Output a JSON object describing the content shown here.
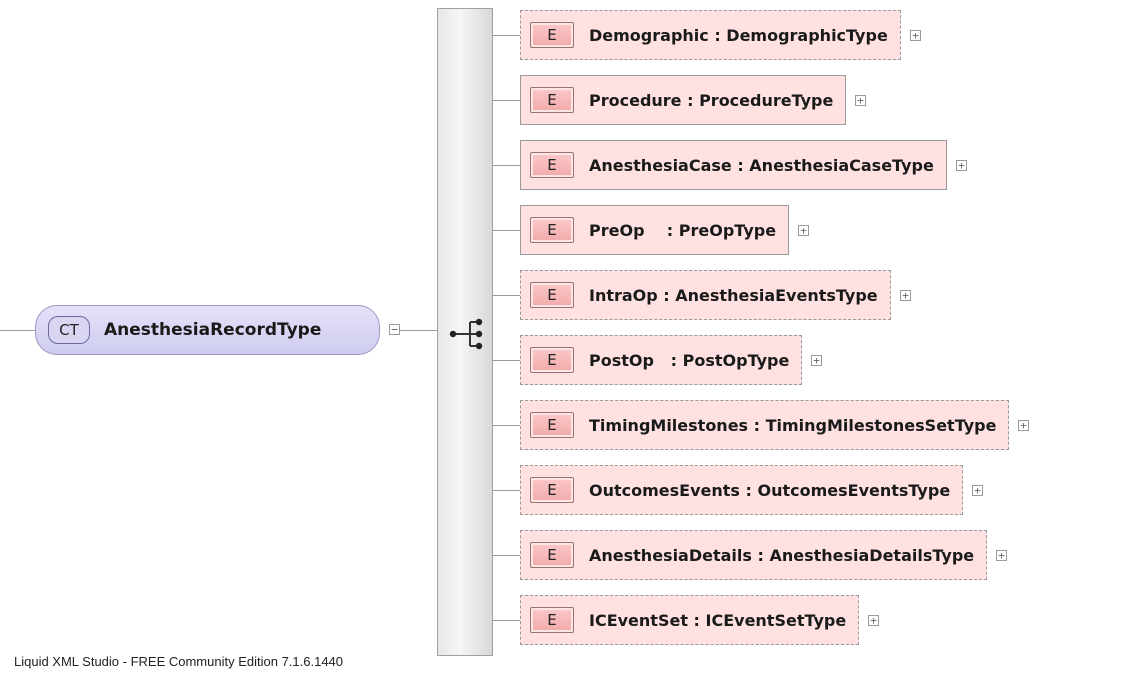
{
  "root": {
    "badge": "CT",
    "name": "AnesthesiaRecordType",
    "toggle": "−"
  },
  "elements": [
    {
      "badge": "E",
      "label": "Demographic : DemographicType",
      "optional": true,
      "toggle": "+"
    },
    {
      "badge": "E",
      "label": "Procedure : ProcedureType",
      "optional": false,
      "toggle": "+"
    },
    {
      "badge": "E",
      "label": "AnesthesiaCase : AnesthesiaCaseType",
      "optional": false,
      "toggle": "+"
    },
    {
      "badge": "E",
      "label": "PreOp    : PreOpType",
      "optional": false,
      "toggle": "+"
    },
    {
      "badge": "E",
      "label": "IntraOp : AnesthesiaEventsType",
      "optional": true,
      "toggle": "+"
    },
    {
      "badge": "E",
      "label": "PostOp   : PostOpType",
      "optional": true,
      "toggle": "+"
    },
    {
      "badge": "E",
      "label": "TimingMilestones : TimingMilestonesSetType",
      "optional": true,
      "toggle": "+"
    },
    {
      "badge": "E",
      "label": "OutcomesEvents : OutcomesEventsType",
      "optional": true,
      "toggle": "+"
    },
    {
      "badge": "E",
      "label": "AnesthesiaDetails : AnesthesiaDetailsType",
      "optional": true,
      "toggle": "+"
    },
    {
      "badge": "E",
      "label": "ICEventSet : ICEventSetType",
      "optional": true,
      "toggle": "+"
    }
  ],
  "compositor": {
    "icon": "sequence-icon"
  },
  "footer": "Liquid XML Studio - FREE Community Edition 7.1.6.1440",
  "colors": {
    "element_fill": "#ffe1e1",
    "element_badge": "#f2a9a9",
    "complex_type_fill": "#d8d6f2",
    "connector": "#9a9a9a"
  }
}
